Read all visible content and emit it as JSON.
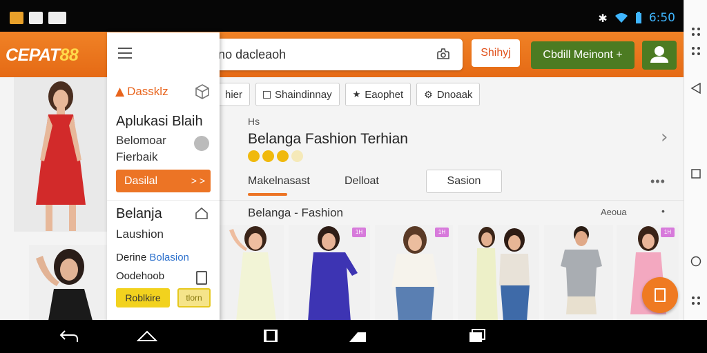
{
  "status_bar": {
    "clock": "6:50",
    "icons": [
      "app-icon",
      "image-icon",
      "grid-icon",
      "bluetooth-icon",
      "wifi-icon",
      "battery-icon"
    ]
  },
  "appbar": {
    "logo_text": "CEPAT",
    "logo_num": "88",
    "search_text": "Ldelaiono dacleaoh",
    "shop_label": "Shihyj",
    "green_button_label": "Cbdill Meinont +",
    "colors": {
      "header": "#ec7425",
      "green": "#4c7b22"
    }
  },
  "drawer": {
    "brand_label": "Dassklz",
    "title1": "Aplukasi Blaih",
    "sub1": "Belomoar",
    "sub2": "Fierbaik",
    "orange_button": "Dasilal",
    "orange_button_arrow": "> >",
    "title2": "Belanja",
    "sub3": "Laushion",
    "sub4_prefix": "Derine ",
    "sub4_link": "Bolasion",
    "sub5": "Oodehoob",
    "yellow_btn1": "Roblkire",
    "yellow_btn2": "tlorn"
  },
  "main": {
    "chips": [
      {
        "label": "hier",
        "icon": ""
      },
      {
        "label": "Shaindinnay",
        "icon": "square-icon"
      },
      {
        "label": "Eaophet",
        "icon": "star-icon"
      },
      {
        "label": "Dnoaak",
        "icon": "gear-icon"
      }
    ],
    "section_small": "Hs",
    "section_title": "Belanga Fashion Terhian",
    "rating": {
      "value": 3.5,
      "max": 4
    },
    "tabs": [
      "Makelnasast",
      "Delloat",
      "Sasion"
    ],
    "active_tab": 0,
    "more": "•••",
    "list_title": "Belanga - Fashion",
    "list_right": "Aeoua",
    "list_right2": "•"
  },
  "products": [
    {
      "tag": ""
    },
    {
      "tag": "1H"
    },
    {
      "tag": "1H"
    },
    {
      "tag": ""
    },
    {
      "tag": ""
    },
    {
      "tag": "1H"
    }
  ]
}
